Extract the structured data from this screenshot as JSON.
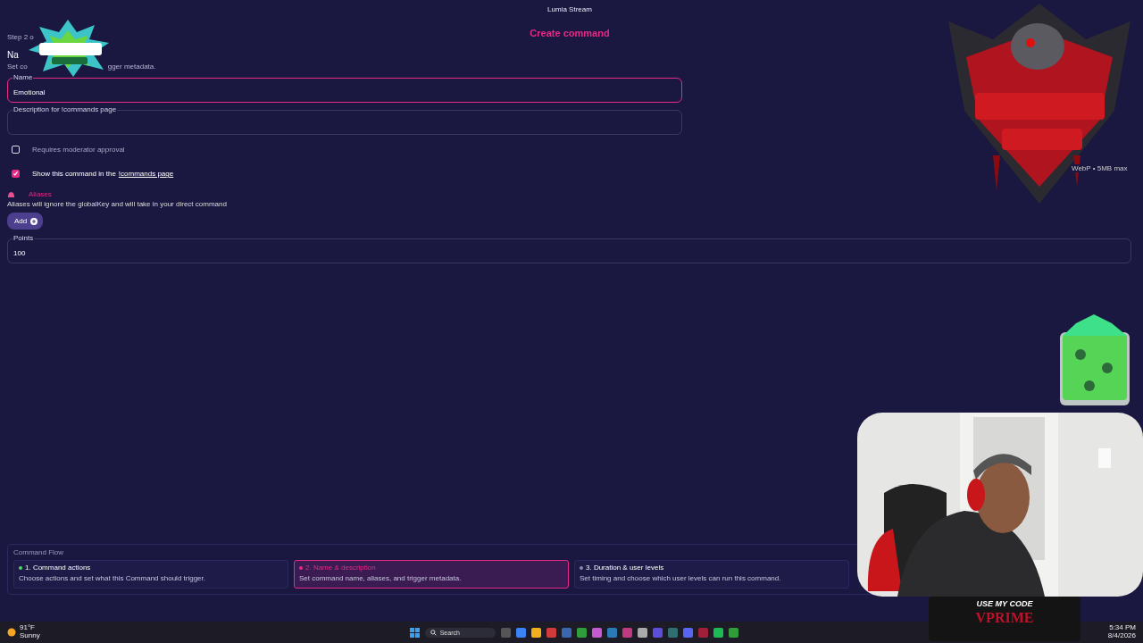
{
  "window": {
    "title": "Lumia Stream"
  },
  "page": {
    "heading": "Create command",
    "step": "Step 2 o",
    "section_title": "Na",
    "subtitle_parts": [
      "Set co",
      "gger metadata."
    ]
  },
  "fields": [
    {
      "label": "Name",
      "value": "Emotional",
      "focused": true
    },
    {
      "label": "Description for !commands page",
      "focused": false
    }
  ],
  "checkboxes": [
    {
      "label": "Requires moderator approval",
      "checked": false
    },
    {
      "label": "Show this command in the",
      "link": "!commands page",
      "checked": true
    }
  ],
  "aliases": {
    "title": "Aliases",
    "note": "Aliases will ignore the globalKey and will take in your direct command",
    "button": "Add"
  },
  "points": {
    "label": "Points",
    "value": "100"
  },
  "flow": {
    "title": "Command Flow",
    "steps": [
      {
        "title": "1. Command actions",
        "description": "Choose actions and set what this Command should trigger.",
        "selected": false,
        "color": "#4cd964"
      },
      {
        "title": "2. Name & description",
        "description": "Set command name, aliases, and trigger metadata.",
        "selected": true,
        "color": "#e62a86"
      },
      {
        "title": "3. Duration & user levels",
        "description": "Set timing and choose which user levels can run this command.",
        "selected": false,
        "color": "#8a8aa8"
      }
    ]
  },
  "overlays": {
    "upload_hint": "WebP • 5MB max",
    "promo": {
      "line1": "USE MY CODE",
      "code": "VPRIME"
    }
  },
  "taskbar": {
    "weather": {
      "temp": "91°F",
      "condition": "Sunny"
    },
    "search": {
      "placeholder": "Search"
    },
    "clock": {
      "time": "5:34 PM",
      "date": "8/4/2026"
    }
  }
}
